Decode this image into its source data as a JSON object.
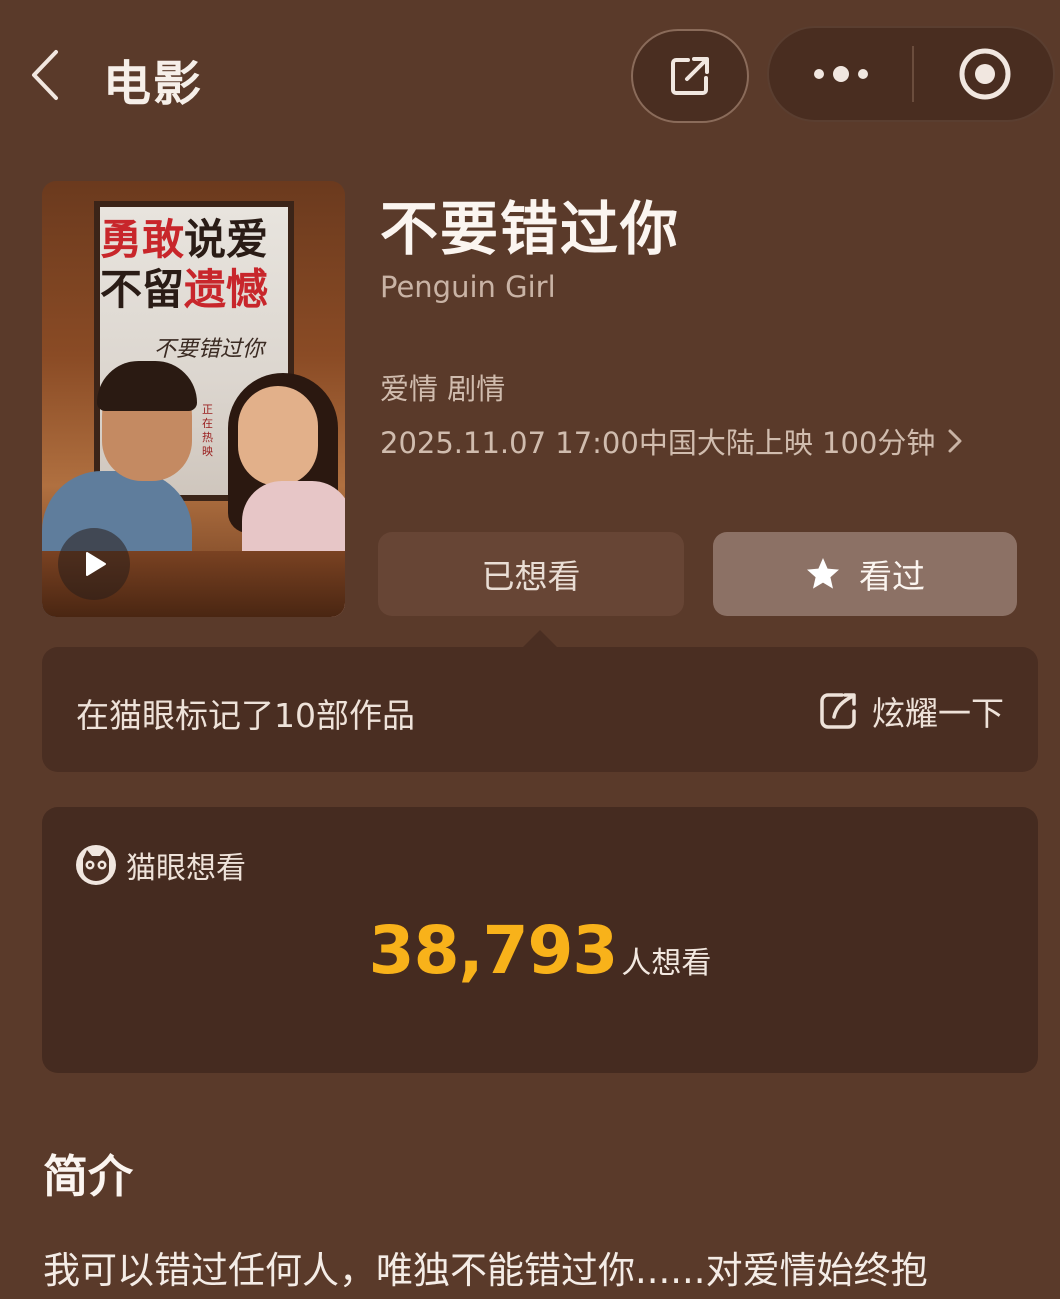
{
  "topbar": {
    "title": "电影",
    "icons": [
      "back-icon",
      "share-icon",
      "more-icon",
      "close-target-icon"
    ]
  },
  "poster": {
    "tagline_line1_red": "勇敢",
    "tagline_line1_dark": "说爱",
    "tagline_line2_dark": "不留",
    "tagline_line2_red": "遗憾",
    "logo": "不要错过你",
    "vertical_text": "正在热映"
  },
  "movie": {
    "title": "不要错过你",
    "english_title": "Penguin Girl",
    "genres": "爱情 剧情",
    "release": "2025.11.07 17:00中国大陆上映 100分钟"
  },
  "actions": {
    "wish_label": "已想看",
    "seen_label": "看过"
  },
  "marked": {
    "text": "在猫眼标记了10部作品",
    "flaunt_label": "炫耀一下"
  },
  "want": {
    "header": "猫眼想看",
    "count": "38,793",
    "unit": "人想看"
  },
  "intro": {
    "title": "简介",
    "text": "我可以错过任何人，唯独不能错过你......对爱情始终抱"
  },
  "colors": {
    "background": "#5a3a2a",
    "card": "#4a2e22",
    "accent_number": "#f8b21a"
  }
}
